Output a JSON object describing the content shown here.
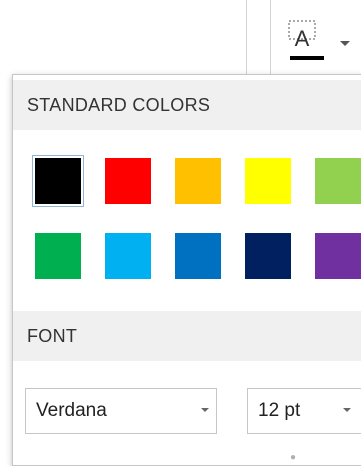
{
  "ribbon": {
    "text_box_icon": "text-box-letter-a-icon",
    "dropdown_icon": "chevron-down-icon",
    "underline_color": "#000000"
  },
  "panel": {
    "standard_colors_heading": "STANDARD COLORS",
    "font_heading": "FONT",
    "swatches": [
      {
        "name": "Black",
        "color": "#000000",
        "selected": true
      },
      {
        "name": "Red",
        "color": "#ff0000",
        "selected": false
      },
      {
        "name": "Orange",
        "color": "#ffc000",
        "selected": false
      },
      {
        "name": "Yellow",
        "color": "#ffff00",
        "selected": false
      },
      {
        "name": "Light Green",
        "color": "#92d050",
        "selected": false
      },
      {
        "name": "Green",
        "color": "#00b050",
        "selected": false
      },
      {
        "name": "Light Blue",
        "color": "#00b0f0",
        "selected": false
      },
      {
        "name": "Blue",
        "color": "#0070c0",
        "selected": false
      },
      {
        "name": "Dark Blue",
        "color": "#002060",
        "selected": false
      },
      {
        "name": "Purple",
        "color": "#7030a0",
        "selected": false
      }
    ],
    "font_family": {
      "value": "Verdana",
      "icon": "chevron-down-icon"
    },
    "font_size": {
      "value": "12 pt",
      "icon": "chevron-down-icon"
    }
  }
}
